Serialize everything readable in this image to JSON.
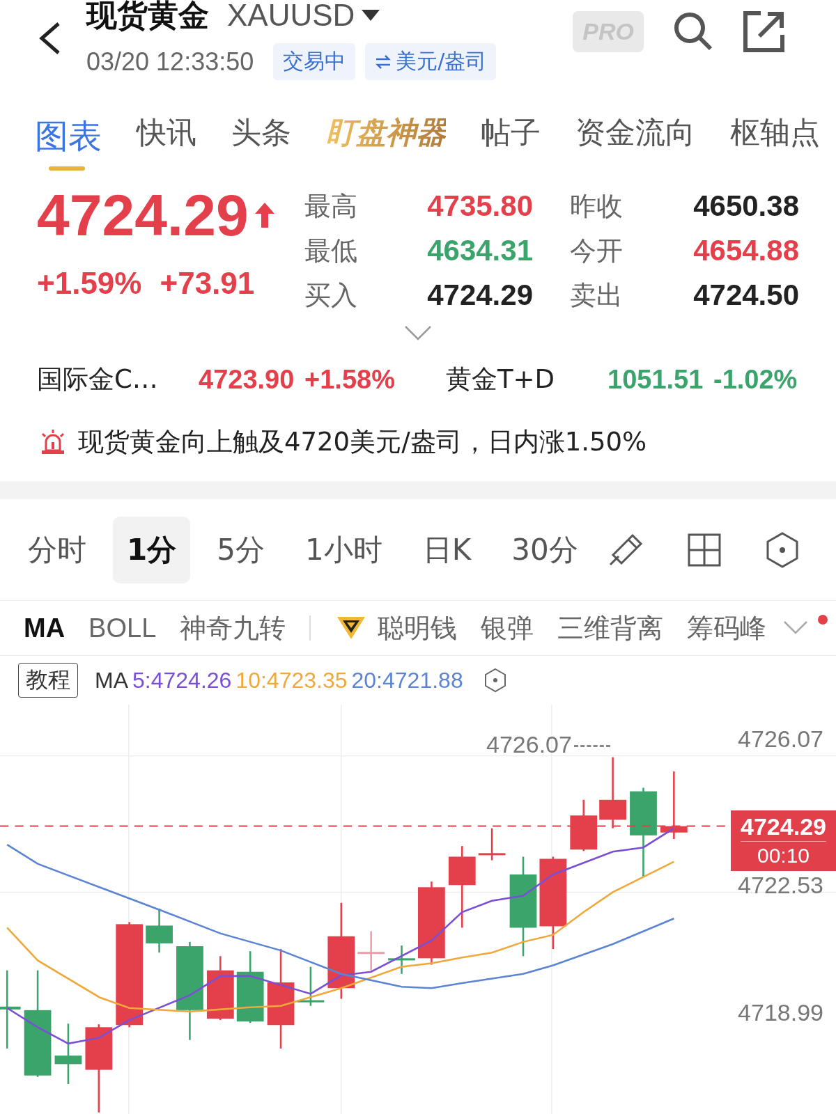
{
  "header": {
    "title": "现货黄金",
    "symbol": "XAUUSD",
    "time": "03/20 12:33:50",
    "pro_badge": "PRO",
    "tags": [
      {
        "label": "交易中",
        "kind": "status"
      },
      {
        "label": "美元/盎司",
        "kind": "unit"
      }
    ]
  },
  "tabs": [
    {
      "label": "图表",
      "selected": true,
      "kind": "normal"
    },
    {
      "label": "快讯",
      "selected": false,
      "kind": "normal"
    },
    {
      "label": "头条",
      "selected": false,
      "kind": "normal"
    },
    {
      "label": "盯盘神器",
      "selected": false,
      "kind": "promo"
    },
    {
      "label": "帖子",
      "selected": false,
      "kind": "normal"
    },
    {
      "label": "资金流向",
      "selected": false,
      "kind": "normal"
    },
    {
      "label": "枢轴点",
      "selected": false,
      "kind": "normal"
    }
  ],
  "quote": {
    "price": "4724.29",
    "color": "#e3404b",
    "rising": true,
    "change_percent": "+1.59%",
    "change": "+73.91"
  },
  "stats": [
    {
      "label": "最高",
      "value": "4735.80",
      "color": "#e3404b"
    },
    {
      "label": "昨收",
      "value": "4650.38",
      "color": "#222222"
    },
    {
      "label": "最低",
      "value": "4634.31",
      "color": "#3aa46a"
    },
    {
      "label": "今开",
      "value": "4654.88",
      "color": "#e3404b"
    },
    {
      "label": "买入",
      "value": "4724.29",
      "color": "#222222"
    },
    {
      "label": "卖出",
      "value": "4724.50",
      "color": "#222222"
    }
  ],
  "related": [
    {
      "name": "国际金C…",
      "value": "4723.90",
      "change": "+1.58%",
      "color": "#e3404b"
    },
    {
      "name": "黄金T+D",
      "value": "1051.51",
      "change": "-1.02%",
      "color": "#3aa46a"
    }
  ],
  "alert": {
    "text": "现货黄金向上触及4720美元/盎司，日内涨1.50%"
  },
  "periods": [
    {
      "label": "分时",
      "selected": false
    },
    {
      "label": "1分",
      "selected": true
    },
    {
      "label": "5分",
      "selected": false
    },
    {
      "label": "1小时",
      "selected": false
    },
    {
      "label": "日K",
      "selected": false
    },
    {
      "label": "30分",
      "selected": false
    }
  ],
  "indicators": [
    {
      "label": "MA",
      "selected": true,
      "kind": "plain"
    },
    {
      "label": "BOLL",
      "selected": false,
      "kind": "plain"
    },
    {
      "label": "神奇九转",
      "selected": false,
      "kind": "plain"
    },
    {
      "label": "聪明钱",
      "selected": false,
      "kind": "premium"
    },
    {
      "label": "银弹",
      "selected": false,
      "kind": "plain"
    },
    {
      "label": "三维背离",
      "selected": false,
      "kind": "plain"
    },
    {
      "label": "筹码峰",
      "selected": false,
      "kind": "plain"
    }
  ],
  "indicator_menu": {
    "new": true
  },
  "legend": {
    "tutorial": "教程",
    "label": "MA",
    "items": [
      {
        "text": "5:4724.26",
        "color": "#7a4fd6"
      },
      {
        "text": "10:4723.35",
        "color": "#f0a83a"
      },
      {
        "text": "20:4721.88",
        "color": "#5b85d4"
      }
    ]
  },
  "chart": {
    "axis_labels": [
      "4726.07",
      "4722.53",
      "4718.99"
    ],
    "high_label": "4726.07",
    "last_price": "4724.29",
    "countdown": "00:10"
  }
}
